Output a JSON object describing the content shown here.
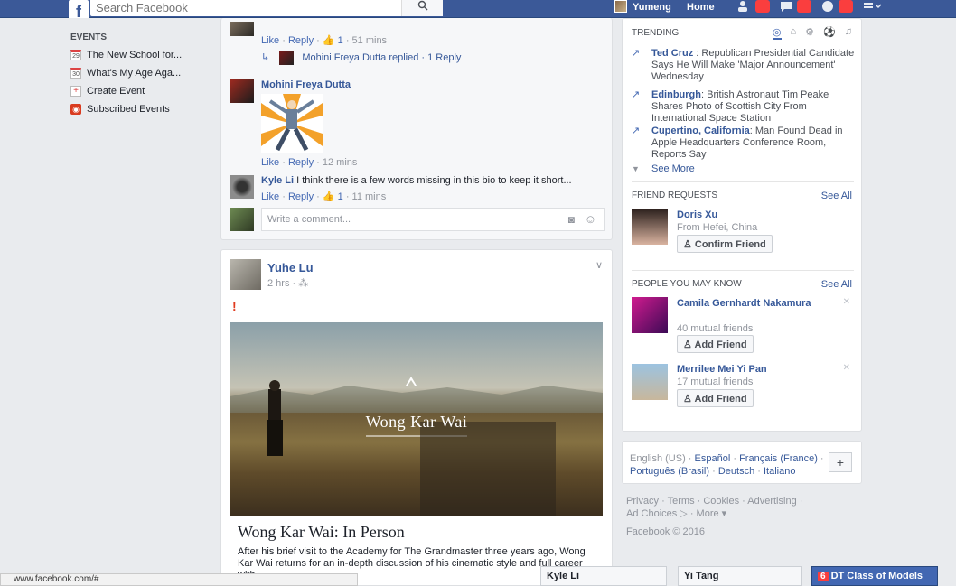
{
  "topbar": {
    "logo": "f",
    "search_placeholder": "Search Facebook",
    "search_icon": "search-icon",
    "user_name": "Yumeng",
    "home_label": "Home"
  },
  "left": {
    "events_header": "EVENTS",
    "items": [
      {
        "icon": "calendar-icon",
        "date": "29",
        "label": "The New School for..."
      },
      {
        "icon": "calendar-icon",
        "date": "30",
        "label": "What's My Age Aga..."
      },
      {
        "icon": "plus-icon",
        "label": "Create Event"
      },
      {
        "icon": "rss-icon",
        "label": "Subscribed Events"
      }
    ]
  },
  "feed": {
    "comments": [
      {
        "meta": "Like · Reply · 1 · 51 mins",
        "like_count": "1"
      },
      {
        "reply_text": "Mohini Freya Dutta replied · 1 Reply"
      },
      {
        "author": "Mohini Freya Dutta",
        "meta": "Like · Reply · 12 mins"
      },
      {
        "author": "Kyle Li",
        "text": "I think there is a few words missing in this bio to keep it short...",
        "meta": "Like · Reply · 1 · 11 mins",
        "like_count": "1"
      }
    ],
    "write_comment_placeholder": "Write a comment...",
    "post": {
      "author": "Yuhe Lu",
      "time": "2 hrs",
      "text": "!",
      "image_title": "Wong Kar Wai",
      "link_title": "Wong Kar Wai: In Person",
      "link_desc": "After his brief visit to the Academy for The Grandmaster three years ago, Wong Kar Wai returns for an in-depth discussion of his cinematic style and full career with"
    }
  },
  "right": {
    "trending_header": "TRENDING",
    "trending": [
      {
        "topic": "Ted Cruz",
        "desc": " : Republican Presidential Candidate Says He Will Make 'Major Announcement' Wednesday"
      },
      {
        "topic": "Edinburgh",
        "desc": ": British Astronaut Tim Peake Shares Photo of Scottish City From International Space Station"
      },
      {
        "topic": "Cupertino, California",
        "desc": ": Man Found Dead in Apple Headquarters Conference Room, Reports Say"
      }
    ],
    "see_more": "See More",
    "friend_requests_header": "FRIEND REQUESTS",
    "see_all": "See All",
    "request": {
      "name": "Doris Xu",
      "sub": "From Hefei, China",
      "button": "Confirm Friend"
    },
    "pymk_header": "PEOPLE YOU MAY KNOW",
    "pymk": [
      {
        "name": "Camila Gernhardt Nakamura",
        "sub": "40 mutual friends",
        "button": "Add Friend"
      },
      {
        "name": "Merrilee Mei Yi Pan",
        "sub": "17 mutual friends",
        "button": "Add Friend"
      }
    ],
    "lang_current": "English (US) · ",
    "languages": [
      "Español",
      "Français (France)",
      "Português (Brasil)",
      "Deutsch",
      "Italiano"
    ],
    "lang_plus": "+",
    "footer_links": "Privacy · Terms · Cookies · Advertising · Ad Choices ▷ · More ▾",
    "copyright": "Facebook © 2016"
  },
  "bottom": {
    "status_url": "www.facebook.com/#",
    "chat_tabs": [
      {
        "label": "Kyle Li"
      },
      {
        "label": "Yi Tang"
      },
      {
        "label": "DT Class of Models",
        "badge": "6"
      }
    ]
  }
}
